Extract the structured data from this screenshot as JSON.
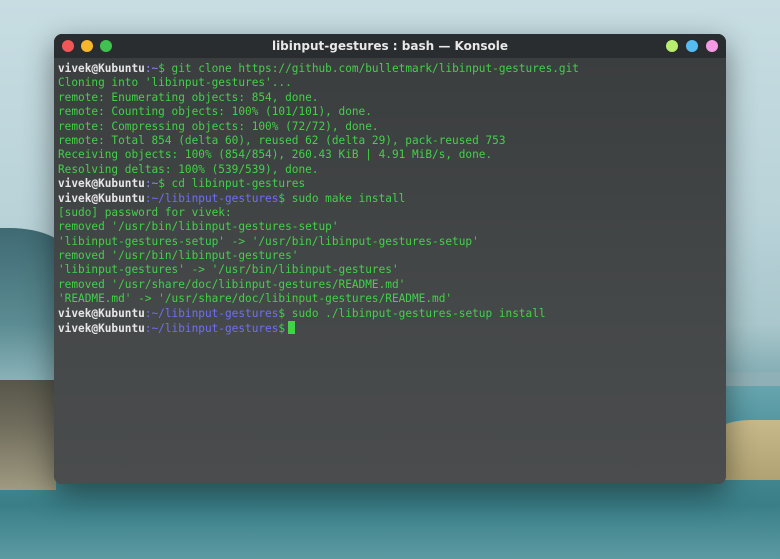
{
  "window": {
    "title": "libinput-gestures : bash — Konsole"
  },
  "colors": {
    "close": "#f25757",
    "minimize": "#f6b62e",
    "maximize": "#3fc24f",
    "extra_green": "#b8ee6f",
    "extra_blue": "#56bdf2",
    "extra_pink": "#f59be6",
    "terminal_text": "#43d04a",
    "prompt_user": "#e7e7e7",
    "prompt_path": "#6f6ff2",
    "cursor": "#43d04a"
  },
  "terminal": {
    "lines": [
      {
        "type": "prompt",
        "user": "vivek@Kubuntu",
        "path": ":~",
        "symbol": "$",
        "cmd": " git clone https://github.com/bulletmark/libinput-gestures.git"
      },
      {
        "type": "out",
        "text": "Cloning into 'libinput-gestures'..."
      },
      {
        "type": "out",
        "text": "remote: Enumerating objects: 854, done."
      },
      {
        "type": "out",
        "text": "remote: Counting objects: 100% (101/101), done."
      },
      {
        "type": "out",
        "text": "remote: Compressing objects: 100% (72/72), done."
      },
      {
        "type": "out",
        "text": "remote: Total 854 (delta 60), reused 62 (delta 29), pack-reused 753"
      },
      {
        "type": "out",
        "text": "Receiving objects: 100% (854/854), 260.43 KiB | 4.91 MiB/s, done."
      },
      {
        "type": "out",
        "text": "Resolving deltas: 100% (539/539), done."
      },
      {
        "type": "prompt",
        "user": "vivek@Kubuntu",
        "path": ":~",
        "symbol": "$",
        "cmd": " cd libinput-gestures"
      },
      {
        "type": "prompt",
        "user": "vivek@Kubuntu",
        "path": ":~/libinput-gestures",
        "symbol": "$",
        "cmd": " sudo make install"
      },
      {
        "type": "out",
        "text": "[sudo] password for vivek:"
      },
      {
        "type": "out",
        "text": "removed '/usr/bin/libinput-gestures-setup'"
      },
      {
        "type": "out",
        "text": "'libinput-gestures-setup' -> '/usr/bin/libinput-gestures-setup'"
      },
      {
        "type": "out",
        "text": "removed '/usr/bin/libinput-gestures'"
      },
      {
        "type": "out",
        "text": "'libinput-gestures' -> '/usr/bin/libinput-gestures'"
      },
      {
        "type": "out",
        "text": "removed '/usr/share/doc/libinput-gestures/README.md'"
      },
      {
        "type": "out",
        "text": "'README.md' -> '/usr/share/doc/libinput-gestures/README.md'"
      },
      {
        "type": "prompt",
        "user": "vivek@Kubuntu",
        "path": ":~/libinput-gestures",
        "symbol": "$",
        "cmd": " sudo ./libinput-gestures-setup install"
      },
      {
        "type": "prompt",
        "user": "vivek@Kubuntu",
        "path": ":~/libinput-gestures",
        "symbol": "$",
        "cmd": "",
        "cursor": true
      }
    ]
  }
}
